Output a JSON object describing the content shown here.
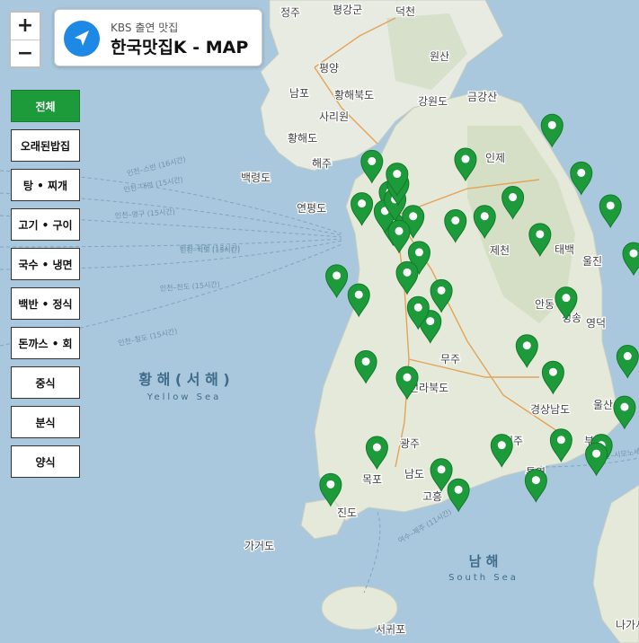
{
  "zoom": {
    "in_label": "+",
    "out_label": "−"
  },
  "header": {
    "subtitle": "KBS 출연 맛집",
    "title": "한국맛집K - MAP"
  },
  "categories": [
    {
      "label": "전체",
      "active": true
    },
    {
      "label": "오래된밥집",
      "active": false
    },
    {
      "label": "탕 • 찌개",
      "active": false
    },
    {
      "label": "고기 • 구이",
      "active": false
    },
    {
      "label": "국수 • 냉면",
      "active": false
    },
    {
      "label": "백반 • 정식",
      "active": false
    },
    {
      "label": "돈까스 • 회",
      "active": false
    },
    {
      "label": "중식",
      "active": false
    },
    {
      "label": "분식",
      "active": false
    },
    {
      "label": "양식",
      "active": false
    }
  ],
  "map": {
    "seas": {
      "yellow_ko": "황 해 ( 서 해 )",
      "yellow_en": "Yellow Sea",
      "south_ko": "남 해",
      "south_en": "South Sea"
    },
    "cities": [
      "정주",
      "평강군",
      "덕천",
      "평양",
      "남포",
      "황해북도",
      "사리원",
      "황해도",
      "해주",
      "강원도",
      "금강산",
      "원산",
      "인제",
      "연평도",
      "태백",
      "울진",
      "제천",
      "안동",
      "청송",
      "영덕",
      "무주",
      "전라북도",
      "경상남도",
      "울산",
      "부산",
      "광주",
      "남도",
      "목포",
      "진도",
      "가거도",
      "고흥",
      "진주",
      "통영",
      "서귀포",
      "나가사키",
      "백령도"
    ],
    "routes": [
      "인천–스반 (16시간)",
      "인천–대련 (15시간)",
      "인천–영구 (15시간)",
      "인천–석도 (15시간)",
      "인천–천도 (15시간)",
      "인천–위해 (13시간)",
      "인천–청도 (15시간)",
      "부산–시모노세키",
      "여수–제주 (11시간)"
    ],
    "marker_color": "#1d9a3a",
    "markers": [
      {
        "lat": 37.88,
        "lng": 127.73
      },
      {
        "lat": 37.75,
        "lng": 128.88
      },
      {
        "lat": 38.2,
        "lng": 128.59
      },
      {
        "lat": 37.57,
        "lng": 126.98
      },
      {
        "lat": 37.46,
        "lng": 126.7
      },
      {
        "lat": 37.27,
        "lng": 127.01
      },
      {
        "lat": 37.39,
        "lng": 126.93
      },
      {
        "lat": 37.5,
        "lng": 127.03
      },
      {
        "lat": 37.65,
        "lng": 127.06
      },
      {
        "lat": 37.74,
        "lng": 127.05
      },
      {
        "lat": 37.86,
        "lng": 126.8
      },
      {
        "lat": 37.34,
        "lng": 127.21
      },
      {
        "lat": 37.2,
        "lng": 127.07
      },
      {
        "lat": 37.0,
        "lng": 127.27
      },
      {
        "lat": 37.3,
        "lng": 127.63
      },
      {
        "lat": 37.34,
        "lng": 127.92
      },
      {
        "lat": 37.52,
        "lng": 128.2
      },
      {
        "lat": 37.17,
        "lng": 128.47
      },
      {
        "lat": 37.44,
        "lng": 129.17
      },
      {
        "lat": 36.99,
        "lng": 129.4
      },
      {
        "lat": 36.64,
        "lng": 127.49
      },
      {
        "lat": 36.35,
        "lng": 127.38
      },
      {
        "lat": 36.81,
        "lng": 127.15
      },
      {
        "lat": 36.48,
        "lng": 127.26
      },
      {
        "lat": 36.78,
        "lng": 126.45
      },
      {
        "lat": 36.6,
        "lng": 126.67
      },
      {
        "lat": 36.57,
        "lng": 128.73
      },
      {
        "lat": 36.02,
        "lng": 129.34
      },
      {
        "lat": 35.87,
        "lng": 128.6
      },
      {
        "lat": 36.12,
        "lng": 128.34
      },
      {
        "lat": 35.54,
        "lng": 129.31
      },
      {
        "lat": 35.18,
        "lng": 129.08
      },
      {
        "lat": 35.1,
        "lng": 129.03
      },
      {
        "lat": 35.23,
        "lng": 128.68
      },
      {
        "lat": 35.18,
        "lng": 128.09
      },
      {
        "lat": 34.85,
        "lng": 128.43
      },
      {
        "lat": 35.82,
        "lng": 127.15
      },
      {
        "lat": 35.97,
        "lng": 126.74
      },
      {
        "lat": 35.16,
        "lng": 126.85
      },
      {
        "lat": 34.81,
        "lng": 126.39
      },
      {
        "lat": 34.95,
        "lng": 127.49
      },
      {
        "lat": 34.76,
        "lng": 127.66
      },
      {
        "lat": 33.5,
        "lng": 126.53
      },
      {
        "lat": 33.25,
        "lng": 126.56
      },
      {
        "lat": 33.39,
        "lng": 126.27
      }
    ]
  }
}
